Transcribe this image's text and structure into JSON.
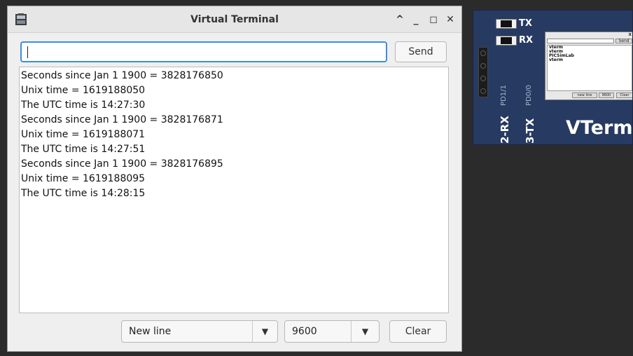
{
  "window": {
    "title": "Virtual Terminal",
    "controls": {
      "maximize_rollup": "^",
      "minimize": "_",
      "restore": "◻",
      "close": "✕"
    }
  },
  "input": {
    "value": "",
    "placeholder": ""
  },
  "send_label": "Send",
  "output_lines": [
    "Seconds since Jan 1 1900 = 3828176850",
    "Unix time = 1619188050",
    "The UTC time is 14:27:30",
    "Seconds since Jan 1 1900 = 3828176871",
    "Unix time = 1619188071",
    "The UTC time is 14:27:51",
    "Seconds since Jan 1 1900 = 3828176895",
    "Unix time = 1619188095",
    "The UTC time is 14:28:15"
  ],
  "line_ending": {
    "selected": "New line"
  },
  "baud_rate": {
    "selected": "9600"
  },
  "clear_label": "Clear",
  "part": {
    "name": "VTerm",
    "leds": [
      "TX",
      "RX"
    ],
    "pins": [
      "2-RX",
      "3-TX"
    ],
    "pin_ports": [
      "PD1/1",
      "PD0/0"
    ],
    "mini": {
      "send_label": "Send",
      "close": "x",
      "lines": [
        "vterm",
        "vterm",
        "PICSimLab",
        "vterm"
      ],
      "line_ending": "new line",
      "baud": "9600",
      "clear": "Clear"
    }
  }
}
